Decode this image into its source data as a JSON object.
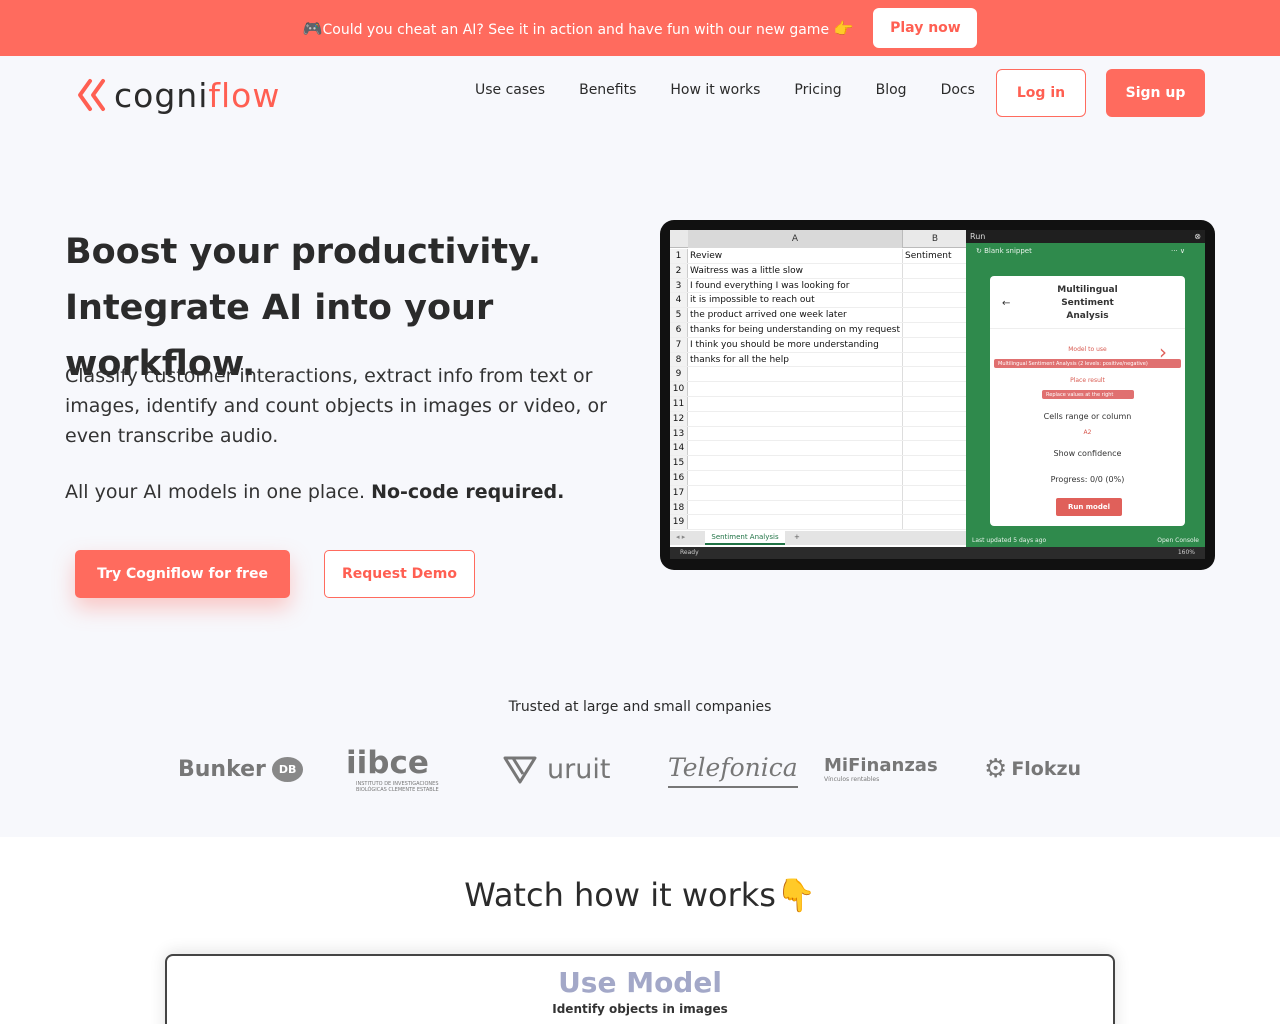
{
  "promo": {
    "icon": "🎮",
    "text": "Could you cheat an AI? See it in action and have fun with our new game",
    "pointer": "👉",
    "button": "Play now"
  },
  "brand": {
    "name_left": "cogni",
    "name_right": "flow",
    "accent_color": "#ff6b5e"
  },
  "nav": {
    "links": [
      "Use cases",
      "Benefits",
      "How it works",
      "Pricing",
      "Blog",
      "Docs"
    ],
    "login": "Log in",
    "signup": "Sign up"
  },
  "hero": {
    "title_line1": "Boost your productivity.",
    "title_line2": "Integrate AI into your workflow.",
    "description": "Classify customer interactions, extract info from text or images, identify and count objects in images or video, or even transcribe audio.",
    "tagline_prefix": "All your AI models in one place. ",
    "tagline_bold": "No-code required.",
    "cta_primary": "Try Cogniflow for free",
    "cta_secondary": "Request Demo"
  },
  "spreadsheet": {
    "col_a": "A",
    "col_b": "B",
    "rows": [
      {
        "n": "1",
        "a": "Review",
        "b": "Sentiment"
      },
      {
        "n": "2",
        "a": "Waitress was a little slow",
        "b": ""
      },
      {
        "n": "3",
        "a": "I found everything I was looking for",
        "b": ""
      },
      {
        "n": "4",
        "a": "it is impossible to reach out",
        "b": ""
      },
      {
        "n": "5",
        "a": "the product arrived one week later",
        "b": ""
      },
      {
        "n": "6",
        "a": "thanks for being understanding on my request",
        "b": ""
      },
      {
        "n": "7",
        "a": "I think you should be more understanding",
        "b": ""
      },
      {
        "n": "8",
        "a": "thanks for all the help",
        "b": ""
      },
      {
        "n": "9",
        "a": "",
        "b": ""
      },
      {
        "n": "10",
        "a": "",
        "b": ""
      },
      {
        "n": "11",
        "a": "",
        "b": ""
      },
      {
        "n": "12",
        "a": "",
        "b": ""
      },
      {
        "n": "13",
        "a": "",
        "b": ""
      },
      {
        "n": "14",
        "a": "",
        "b": ""
      },
      {
        "n": "15",
        "a": "",
        "b": ""
      },
      {
        "n": "16",
        "a": "",
        "b": ""
      },
      {
        "n": "17",
        "a": "",
        "b": ""
      },
      {
        "n": "18",
        "a": "",
        "b": ""
      },
      {
        "n": "19",
        "a": "",
        "b": ""
      }
    ],
    "sheet_tab": "Sentiment Analysis",
    "add_tab": "+",
    "status": "Ready",
    "zoom": "160%"
  },
  "addin": {
    "header": "Run",
    "snippet": "Blank snippet",
    "menu": "··· ∨",
    "model_title_1": "Multilingual",
    "model_title_2": "Sentiment",
    "model_title_3": "Analysis",
    "back": "←",
    "model_label": "Model to use",
    "model_value": "Multilingual Sentiment Analysis (2 levels: positive/negative)",
    "place_label": "Place result",
    "place_value": "Replace values at the right",
    "cells_label": "Cells range or column",
    "cells_value": "A2",
    "confidence_label": "Show confidence",
    "progress": "Progress: 0/0 (0%)",
    "run_button": "Run model",
    "last_updated": "Last updated 5 days ago",
    "console": "Open Console"
  },
  "trusted": {
    "heading": "Trusted at large and small companies",
    "logos": {
      "bunker": "Bunker",
      "bunker_badge": "DB",
      "iibce": "iibce",
      "iibce_sub_1": "INSTITUTO DE INVESTIGACIONES",
      "iibce_sub_2": "BIOLÓGICAS CLEMENTE ESTABLE",
      "uruit": "uruit",
      "telefonica": "Telefonica",
      "mifinanzas": "MiFinanzas",
      "mifinanzas_sub": "Vínculos rentables",
      "flokzu": "Flokzu"
    }
  },
  "watch": {
    "title": "Watch how it works",
    "pointer": "👇",
    "video_title": "Use Model",
    "video_subtitle": "Identify objects in images"
  }
}
